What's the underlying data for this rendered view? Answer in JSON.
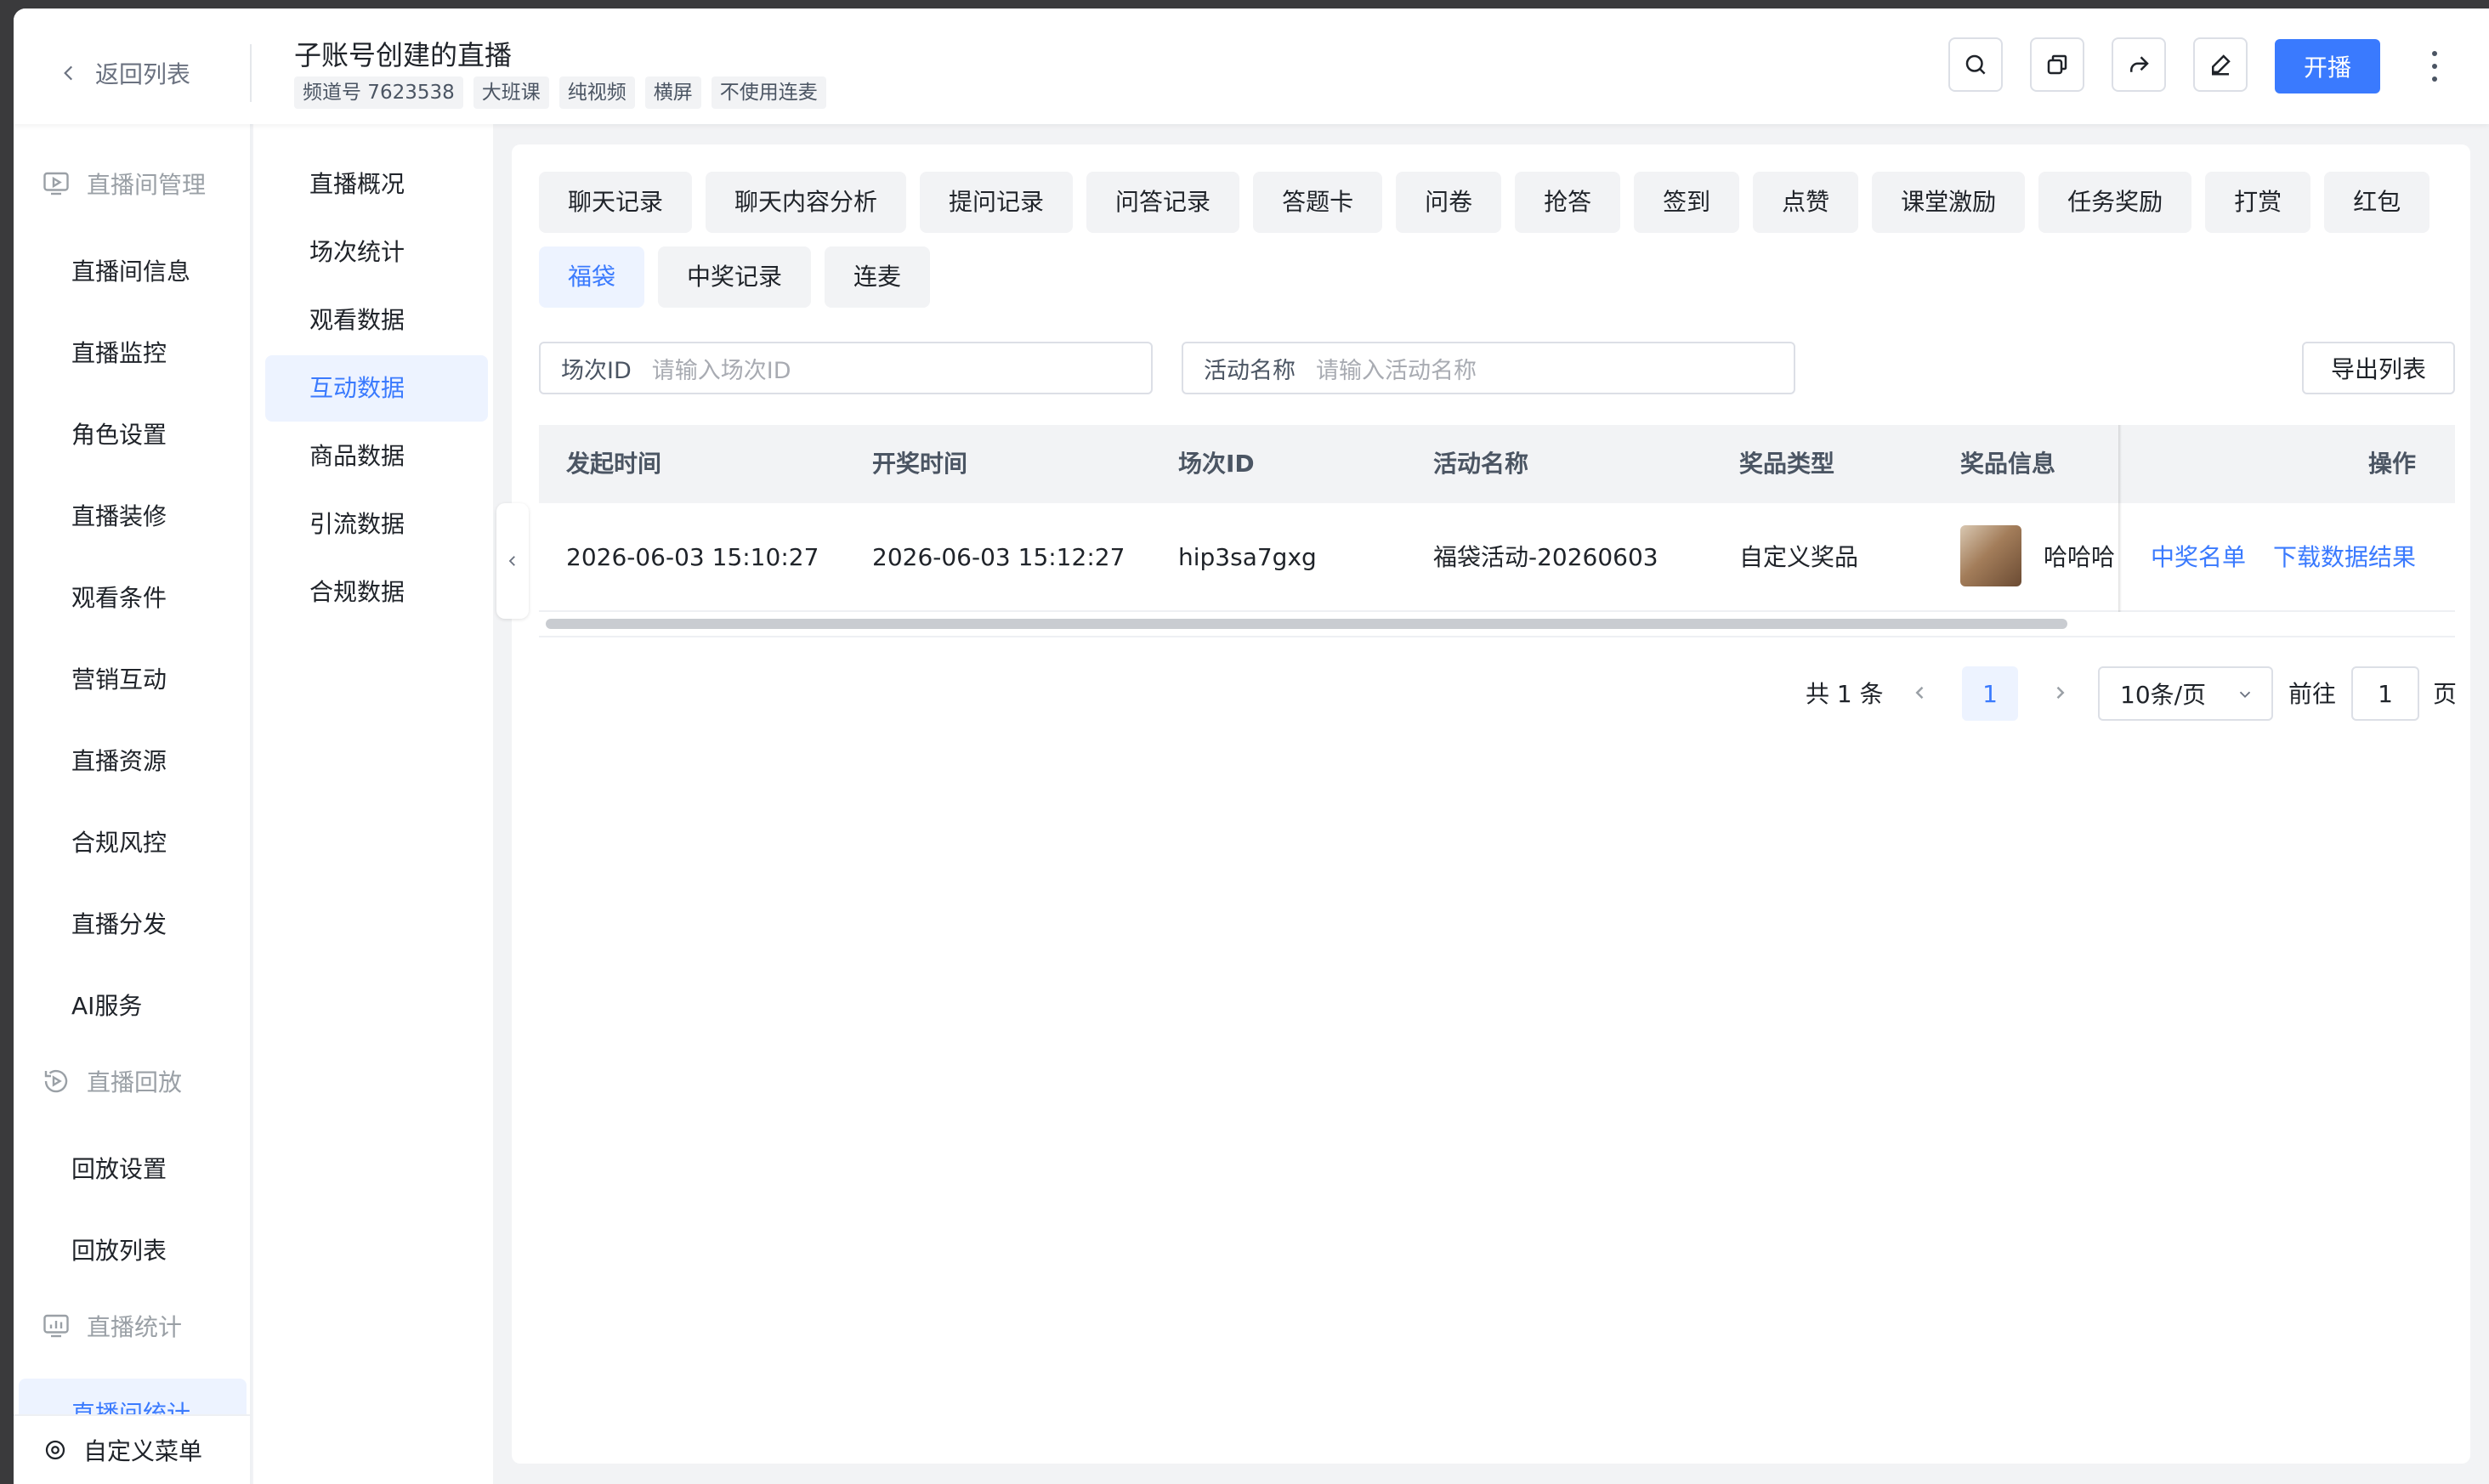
{
  "header": {
    "back_label": "返回列表",
    "title": "子账号创建的直播",
    "tags": [
      "频道号 7623538",
      "大班课",
      "纯视频",
      "横屏",
      "不使用连麦"
    ],
    "live_button": "开播",
    "icons": [
      "search-icon",
      "copy-icon",
      "share-icon",
      "edit-icon",
      "more-icon"
    ]
  },
  "sidebar": {
    "group_live": "直播间管理",
    "items_live": [
      "直播间信息",
      "直播监控",
      "角色设置",
      "直播装修",
      "观看条件",
      "营销互动",
      "直播资源",
      "合规风控",
      "直播分发",
      "AI服务"
    ],
    "group_replay": "直播回放",
    "items_replay": [
      "回放设置",
      "回放列表"
    ],
    "group_stats": "直播统计",
    "active_item": "直播间统计",
    "custom_menu": "自定义菜单"
  },
  "subnav": {
    "items": [
      "直播概况",
      "场次统计",
      "观看数据",
      "互动数据",
      "商品数据",
      "引流数据",
      "合规数据"
    ],
    "active": "互动数据"
  },
  "tabs": [
    "聊天记录",
    "聊天内容分析",
    "提问记录",
    "问答记录",
    "答题卡",
    "问卷",
    "抢答",
    "签到",
    "点赞",
    "课堂激励",
    "任务奖励",
    "打赏",
    "红包",
    "福袋",
    "中奖记录",
    "连麦"
  ],
  "active_tab": "福袋",
  "filters": {
    "session_label": "场次ID",
    "session_placeholder": "请输入场次ID",
    "activity_label": "活动名称",
    "activity_placeholder": "请输入活动名称",
    "export_label": "导出列表"
  },
  "table": {
    "columns": [
      "发起时间",
      "开奖时间",
      "场次ID",
      "活动名称",
      "奖品类型",
      "奖品信息",
      "操作"
    ],
    "rows": [
      {
        "start_time": "2026-06-03 15:10:27",
        "draw_time": "2026-06-03 15:12:27",
        "session_id": "hip3sa7gxg",
        "activity_name": "福袋活动-20260603",
        "prize_type": "自定义奖品",
        "prize_info": "哈哈哈",
        "actions": [
          "中奖名单",
          "下载数据结果"
        ]
      }
    ]
  },
  "pagination": {
    "total": "共 1 条",
    "current_page": "1",
    "page_size": "10条/页",
    "goto_label": "前往",
    "goto_value": "1",
    "page_suffix": "页"
  },
  "colors": {
    "accent": "#3a7afe",
    "active_bg": "#edf3ff"
  }
}
